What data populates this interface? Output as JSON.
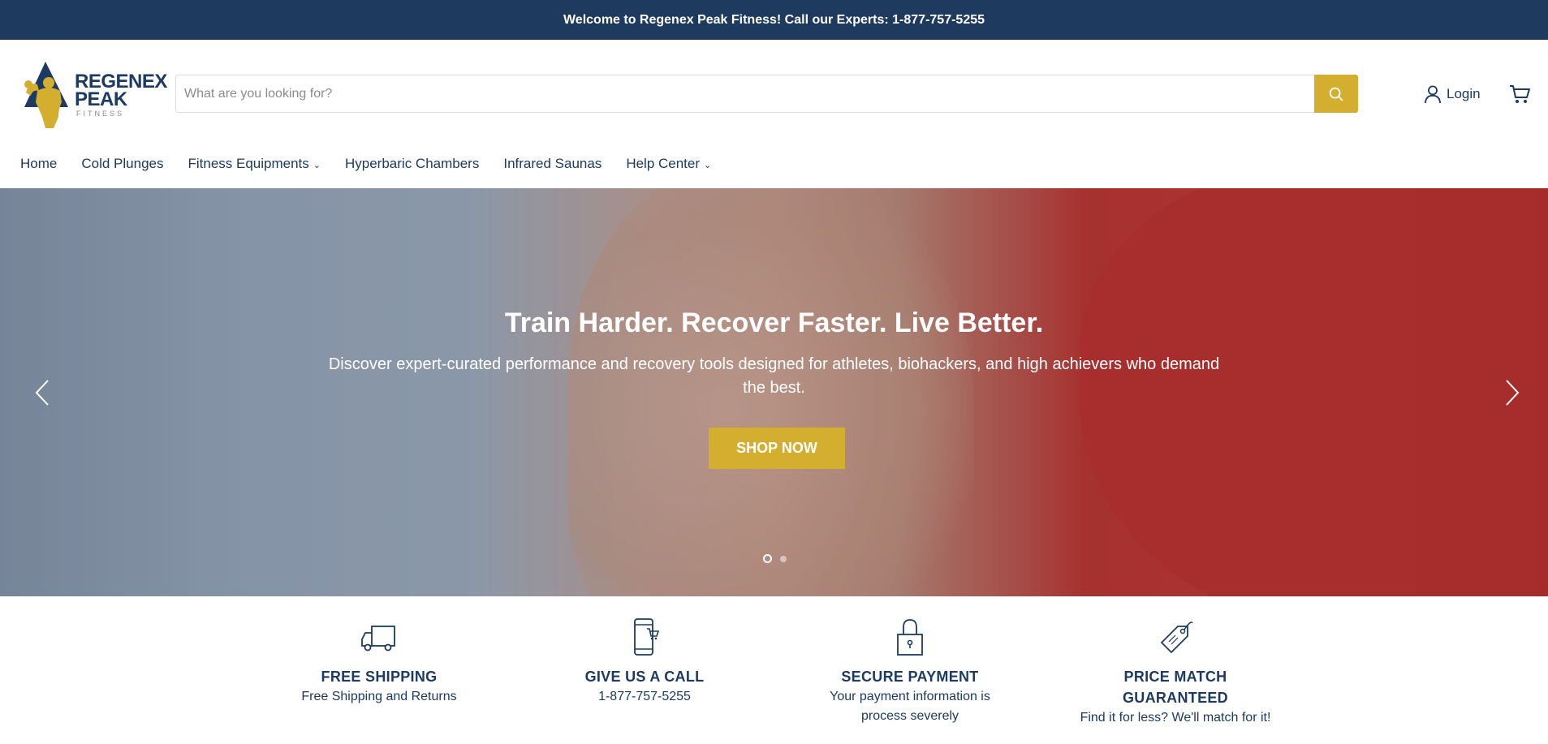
{
  "announcement": {
    "text": "Welcome to Regenex Peak Fitness! Call our Experts: 1-877-757-5255"
  },
  "logo": {
    "line1": "REGENEX",
    "line2": "PEAK",
    "sub": "FITNESS"
  },
  "search": {
    "placeholder": "What are you looking for?",
    "icon": "search-icon"
  },
  "header": {
    "login_label": "Login",
    "login_icon": "user-icon",
    "cart_icon": "cart-icon"
  },
  "nav": {
    "items": [
      {
        "label": "Home",
        "has_dropdown": false
      },
      {
        "label": "Cold Plunges",
        "has_dropdown": false
      },
      {
        "label": "Fitness Equipments",
        "has_dropdown": true
      },
      {
        "label": "Hyperbaric Chambers",
        "has_dropdown": false
      },
      {
        "label": "Infrared Saunas",
        "has_dropdown": false
      },
      {
        "label": "Help Center",
        "has_dropdown": true
      }
    ]
  },
  "hero": {
    "title": "Train Harder. Recover Faster. Live Better.",
    "subtitle": "Discover expert-curated performance and recovery tools designed for athletes, biohackers, and high achievers who demand the best.",
    "cta_label": "SHOP NOW",
    "slide_count": 2,
    "active_slide": 1
  },
  "features": [
    {
      "icon": "truck-icon",
      "title": "FREE SHIPPING",
      "text": "Free Shipping and Returns"
    },
    {
      "icon": "phone-cart-icon",
      "title": "GIVE US A CALL",
      "text": "1-877-757-5255"
    },
    {
      "icon": "lock-icon",
      "title": "SECURE PAYMENT",
      "text": "Your payment information is process severely"
    },
    {
      "icon": "price-tag-icon",
      "title": "PRICE MATCH GUARANTEED",
      "text": "Find it for less? We'll match for it!"
    }
  ],
  "colors": {
    "navy": "#1e3a5f",
    "gold": "#d4ae2f",
    "text": "#1c3a63",
    "white": "#ffffff"
  }
}
